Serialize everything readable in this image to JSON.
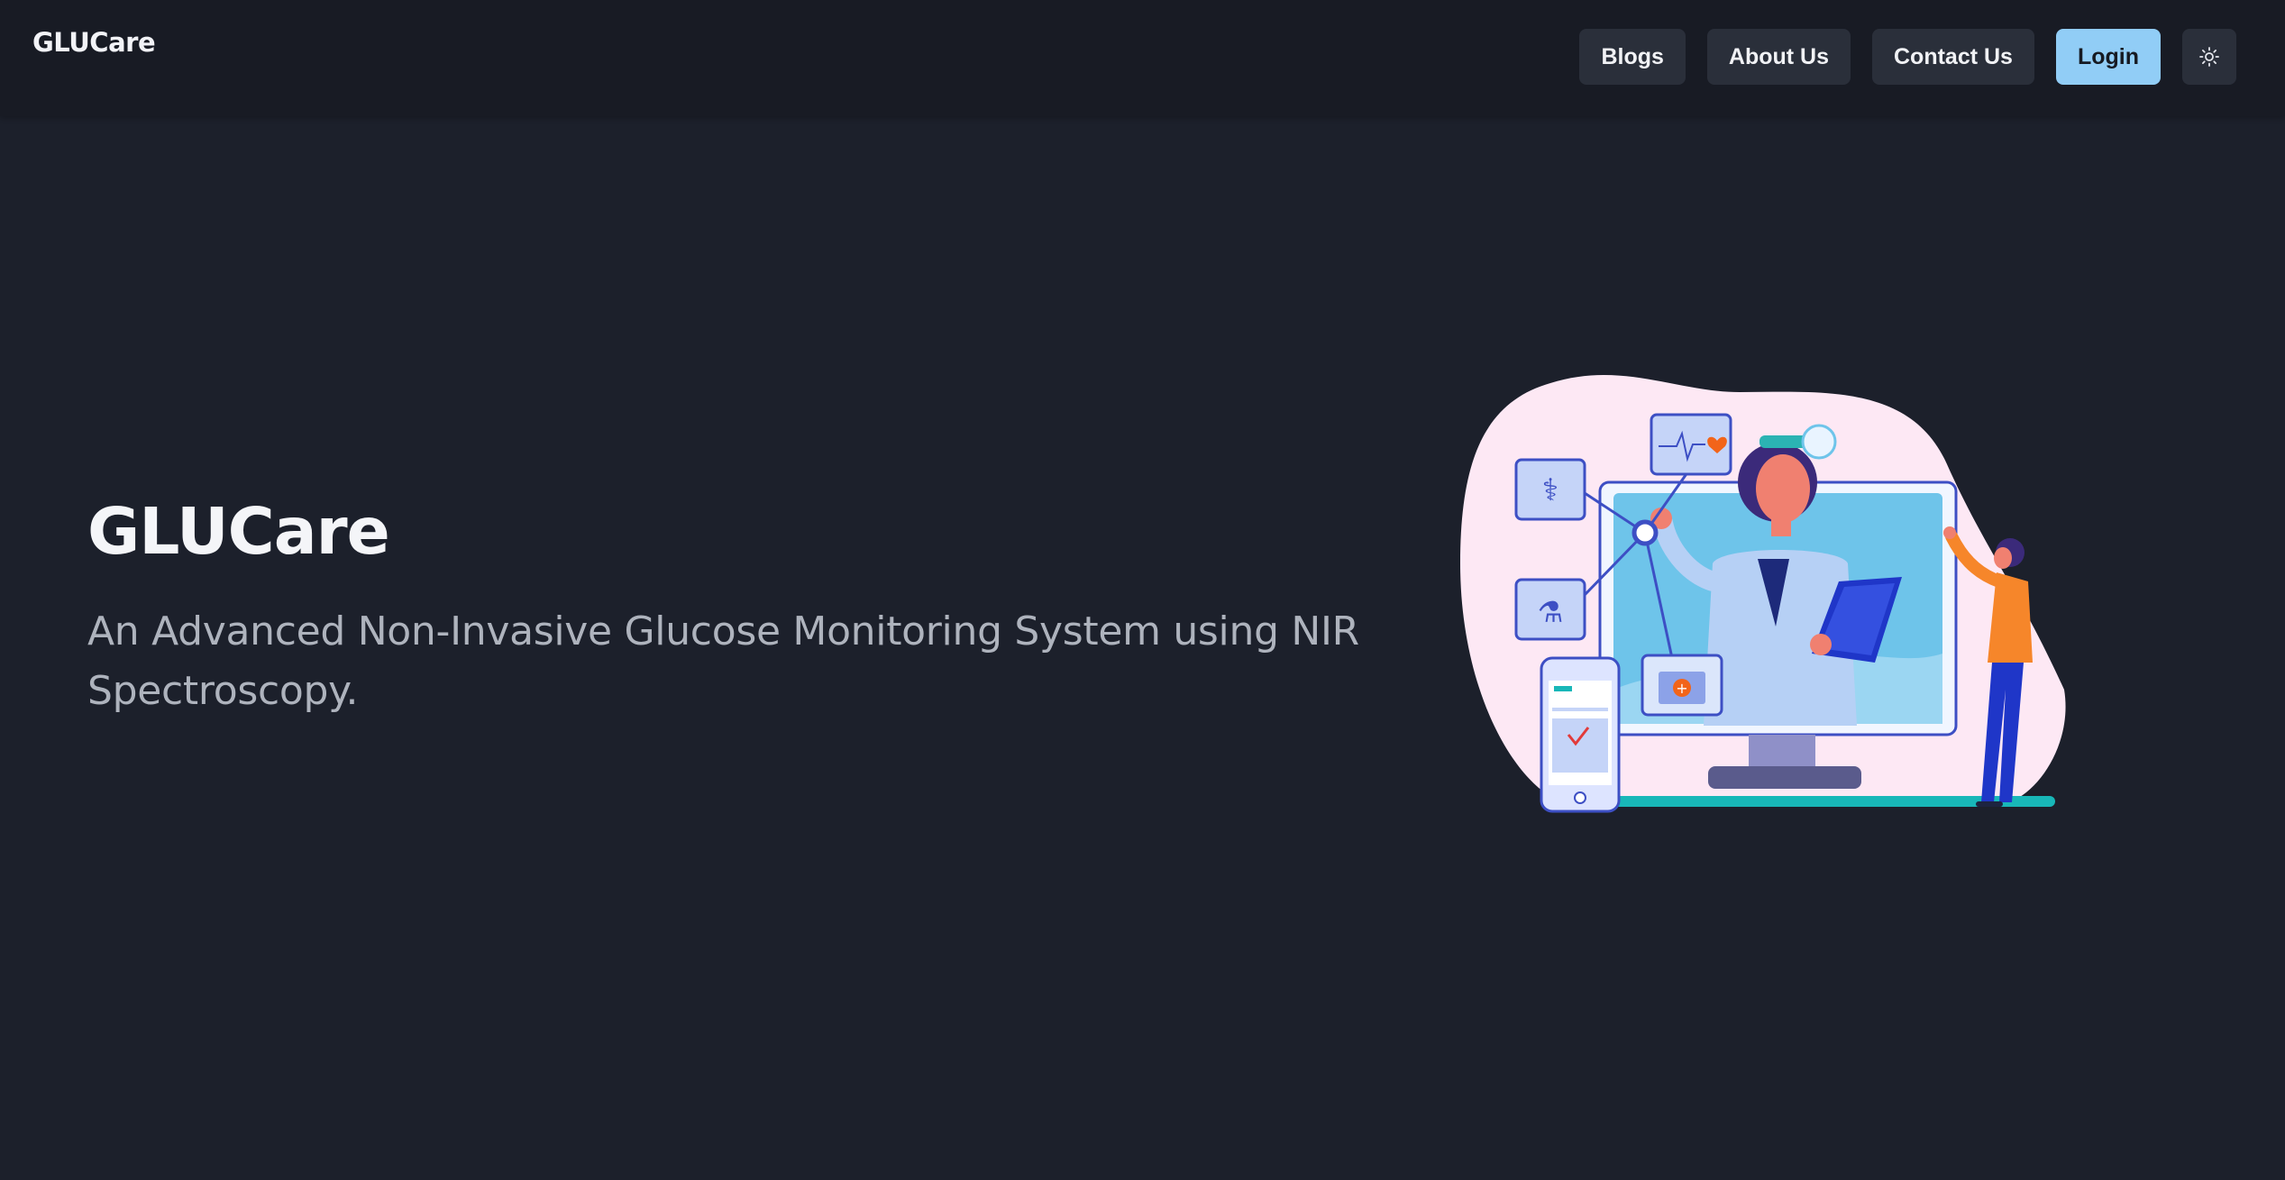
{
  "navbar": {
    "brand": "GLUCare",
    "links": [
      "Blogs",
      "About Us",
      "Contact Us"
    ],
    "login_label": "Login",
    "theme_toggle_icon": "sun-icon"
  },
  "hero": {
    "title": "GLUCare",
    "subtitle": "An Advanced Non-Invasive Glucose Monitoring System using NIR Spectroscopy.",
    "illustration": "telemedicine-doctor-illustration"
  },
  "colors": {
    "page_bg": "#1c202b",
    "navbar_bg": "#181b24",
    "button_bg": "#2a2f3a",
    "login_bg": "#91cdf6"
  }
}
